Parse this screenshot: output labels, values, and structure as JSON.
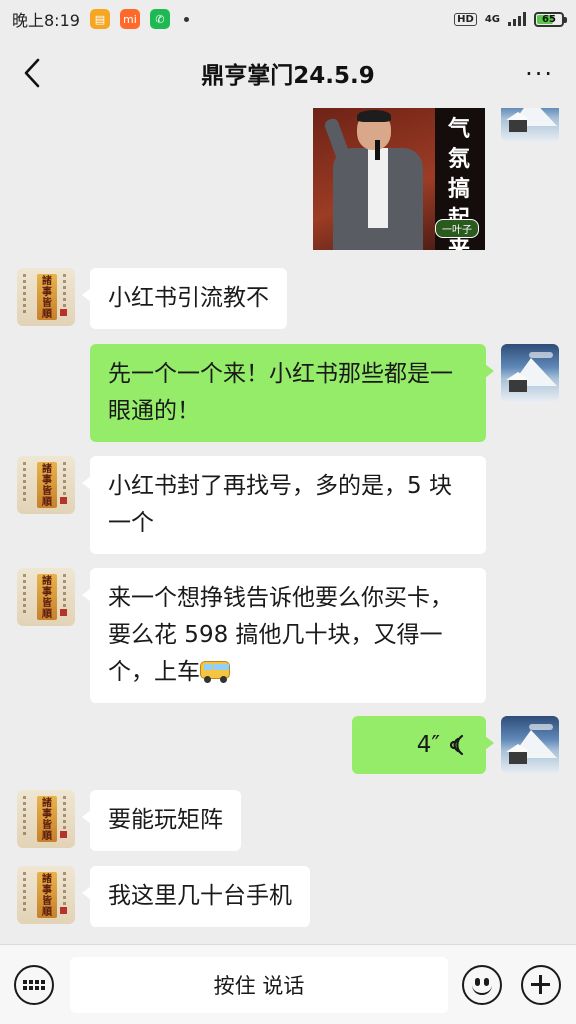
{
  "status_bar": {
    "time": "晚上8:19",
    "hd": "HD",
    "network": "4G",
    "battery_level": "65",
    "battery_fraction": 0.65,
    "app_icons": [
      {
        "name": "notes-app-icon",
        "color": "#f5a623"
      },
      {
        "name": "mi-store-icon",
        "color": "#ff6a2b"
      },
      {
        "name": "phone-icon",
        "color": "#1fb954"
      }
    ]
  },
  "header": {
    "title": "鼎亨掌门24.5.9",
    "more": "···"
  },
  "sticker": {
    "text": "气氛搞起来",
    "tag": "一叶子"
  },
  "messages": [
    {
      "side": "left",
      "text": "小红书引流教不"
    },
    {
      "side": "right",
      "text": "先一个一个来！小红书那些都是一眼通的！"
    },
    {
      "side": "left",
      "text": "小红书封了再找号，多的是，5 块一个"
    },
    {
      "side": "left",
      "text": "来一个想挣钱告诉他要么你买卡，要么花 598 搞他几十块，又得一个，上车",
      "emoji": "bus-icon"
    },
    {
      "side": "right",
      "type": "voice",
      "duration": "4″"
    },
    {
      "side": "left",
      "text": "要能玩矩阵"
    },
    {
      "side": "left",
      "text": "我这里几十台手机"
    }
  ],
  "avatar_left_text": "諸事皆順",
  "input_bar": {
    "hold_to_talk": "按住 说话"
  },
  "colors": {
    "background": "#ededed",
    "bubble_self": "#95ec69",
    "bubble_other": "#ffffff"
  }
}
